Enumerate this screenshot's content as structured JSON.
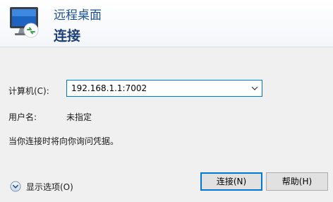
{
  "header": {
    "app_title": "远程桌面",
    "heading": "连接",
    "icon": "remote-desktop-icon"
  },
  "form": {
    "computer_label": "计算机(C):",
    "computer_value": "192.168.1.1:7002",
    "username_label": "用户名:",
    "username_value": "未指定",
    "credentials_note": "当你连接时将向你询问凭据。"
  },
  "options": {
    "label": "显示选项(O)",
    "icon": "chevron-down-circle-icon"
  },
  "buttons": {
    "connect": "连接(N)",
    "help": "帮助(H)"
  },
  "colors": {
    "accent": "#0078d7",
    "title": "#1e4f93"
  }
}
